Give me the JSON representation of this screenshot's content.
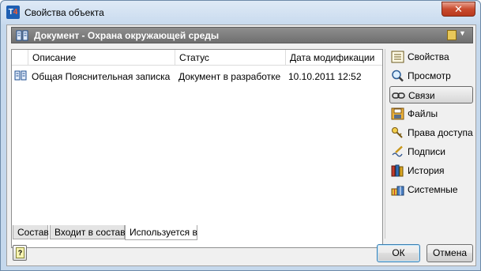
{
  "window": {
    "title": "Свойства объекта",
    "close_glyph": "✕",
    "icon_text_1": "T",
    "icon_text_2": "4"
  },
  "header": {
    "title": "Документ - Охрана окружающей среды",
    "menu_glyph": "▼"
  },
  "table": {
    "columns": [
      "Описание",
      "Статус",
      "Дата модификации"
    ],
    "rows": [
      {
        "description": "Общая Пояснительная записка",
        "status": "Документ в разработке",
        "modified": "10.10.2011 12:52"
      }
    ]
  },
  "tabs": [
    "Состав",
    "Входит в состав",
    "Используется в"
  ],
  "active_tab": "Используется в",
  "sidebar": {
    "items": [
      {
        "label": "Свойства",
        "icon": "properties-icon"
      },
      {
        "label": "Просмотр",
        "icon": "magnifier-icon"
      },
      {
        "label": "Связи",
        "icon": "link-icon"
      },
      {
        "label": "Файлы",
        "icon": "floppy-disk-icon"
      },
      {
        "label": "Права доступа",
        "icon": "key-icon"
      },
      {
        "label": "Подписи",
        "icon": "signature-pen-icon"
      },
      {
        "label": "История",
        "icon": "books-icon"
      },
      {
        "label": "Системные",
        "icon": "system-gifts-icon"
      }
    ],
    "active": "Связи"
  },
  "buttons": {
    "ok": "ОК",
    "cancel": "Отмена",
    "help_glyph": "?"
  },
  "colors": {
    "header_bg": "#7f7f7f",
    "accent_blue": "#1e5fb3",
    "close_red": "#c94b2e"
  }
}
